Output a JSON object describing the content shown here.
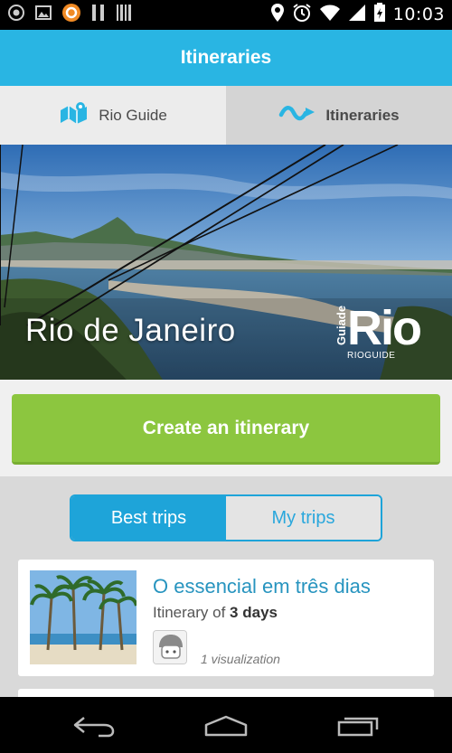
{
  "status_bar": {
    "time": "10:03",
    "left_icons": [
      "record-icon",
      "image-icon",
      "app-circle-icon",
      "pause-icon",
      "barcode-icon"
    ],
    "right_icons": [
      "location-pin-icon",
      "alarm-icon",
      "wifi-icon",
      "cell-signal-icon",
      "battery-icon"
    ]
  },
  "app_bar": {
    "title": "Itineraries"
  },
  "tabs": [
    {
      "label": "Rio Guide",
      "icon": "map-icon",
      "selected": false
    },
    {
      "label": "Itineraries",
      "icon": "wave-route-icon",
      "selected": true
    }
  ],
  "hero": {
    "city": "Rio de Janeiro",
    "logo": {
      "small": "Guiade",
      "big": "Rio",
      "sub": "RIOGUIDE"
    }
  },
  "create_button": {
    "label": "Create an itinerary"
  },
  "segment": {
    "options": [
      {
        "label": "Best trips",
        "active": true
      },
      {
        "label": "My trips",
        "active": false
      }
    ]
  },
  "trips": [
    {
      "title": "O essencial em três dias",
      "subtitle_prefix": "Itinerary of",
      "subtitle_value": "3 days",
      "views": "1 visualization"
    }
  ],
  "colors": {
    "primary": "#29b5e3",
    "accent_blue": "#1ea4d9",
    "green": "#8cc63f",
    "title_blue": "#2794bf"
  }
}
